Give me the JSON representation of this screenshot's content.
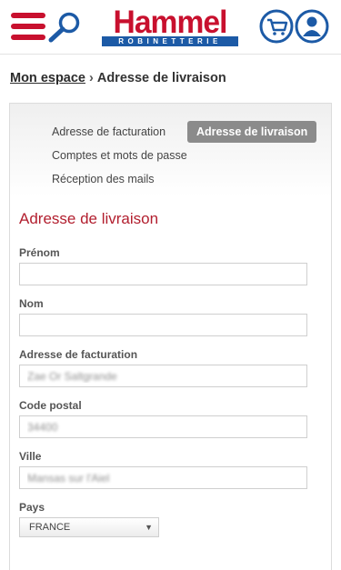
{
  "header": {
    "logo_name": "Hammel",
    "logo_sub": "ROBINETTERIE",
    "colors": {
      "brand_red": "#c8102e",
      "brand_blue": "#1c5aa6"
    },
    "icons": [
      "menu-icon",
      "search-icon",
      "cart-icon",
      "user-icon"
    ]
  },
  "breadcrumb": {
    "parent": "Mon espace",
    "separator": "›",
    "current": "Adresse de livraison"
  },
  "subnav": {
    "billing": "Adresse de facturation",
    "delivery": "Adresse de livraison",
    "accounts": "Comptes et mots de passe",
    "mails": "Réception des mails"
  },
  "form": {
    "title": "Adresse de livraison",
    "firstname": {
      "label": "Prénom",
      "value": ""
    },
    "lastname": {
      "label": "Nom",
      "value": ""
    },
    "address": {
      "label": "Adresse de facturation",
      "value": "Zae Or Saltgrande"
    },
    "postcode": {
      "label": "Code postal",
      "value": "34400"
    },
    "city": {
      "label": "Ville",
      "value": "Mansas sur l'Aiel"
    },
    "country": {
      "label": "Pays",
      "value": "FRANCE"
    }
  }
}
